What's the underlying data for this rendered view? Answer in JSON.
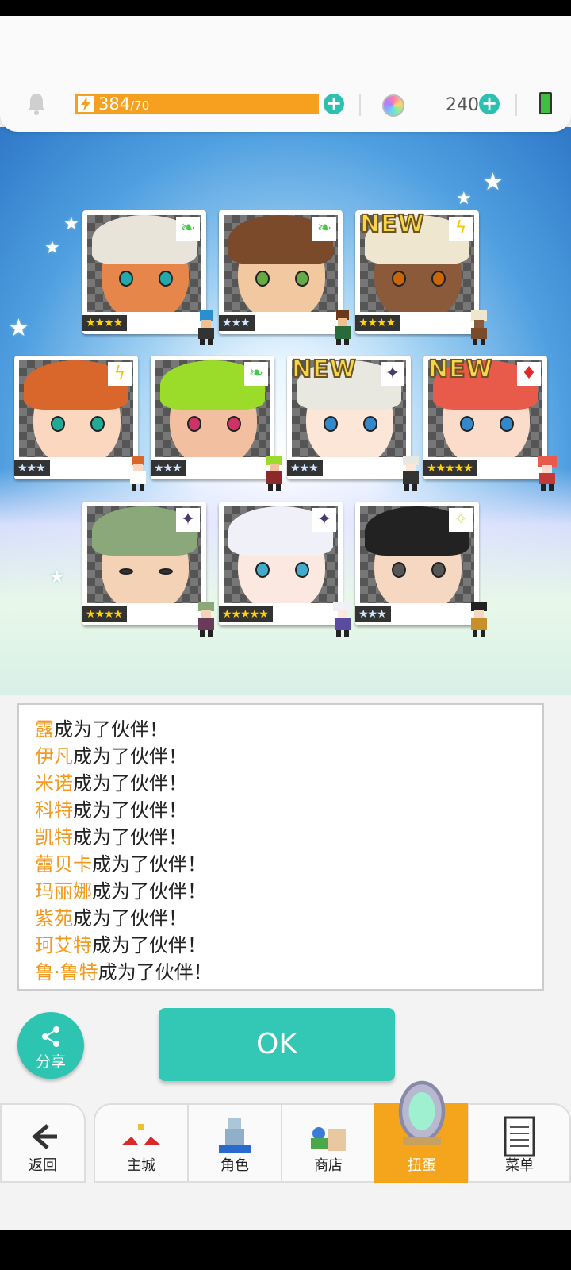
{
  "topbar": {
    "stamina_current": "384",
    "stamina_max": "/70",
    "gem_count": "240"
  },
  "cards": [
    {
      "stars": "★★★★",
      "rank_color": "gold",
      "badge": "leaf",
      "new": false
    },
    {
      "stars": "★★★",
      "rank_color": "silver",
      "badge": "leaf",
      "new": false
    },
    {
      "stars": "★★★★",
      "rank_color": "gold",
      "badge": "lightning",
      "new": true
    },
    {
      "stars": "★★★",
      "rank_color": "silver",
      "badge": "lightning",
      "new": false
    },
    {
      "stars": "★★★",
      "rank_color": "silver",
      "badge": "leaf",
      "new": false
    },
    {
      "stars": "★★★",
      "rank_color": "silver",
      "badge": "dark-star",
      "new": true
    },
    {
      "stars": "★★★★★",
      "rank_color": "gold",
      "badge": "fire-diamonds",
      "new": true
    },
    {
      "stars": "★★★★",
      "rank_color": "gold",
      "badge": "dark-star",
      "new": false
    },
    {
      "stars": "★★★★★",
      "rank_color": "gold",
      "badge": "dark-star",
      "new": false
    },
    {
      "stars": "★★★",
      "rank_color": "silver",
      "badge": "light-star",
      "new": false
    }
  ],
  "new_label": "NEW",
  "results": {
    "suffix": "成为了伙伴！",
    "names": [
      "露",
      "伊凡",
      "米诺",
      "科特",
      "凯特",
      "蕾贝卡",
      "玛丽娜",
      "紫苑",
      "珂艾特",
      "鲁·鲁特"
    ]
  },
  "share_label": "分享",
  "ok_label": "OK",
  "nav": {
    "back": "返回",
    "home": "主城",
    "character": "角色",
    "shop": "商店",
    "gacha": "扭蛋",
    "menu": "菜单"
  },
  "colors": {
    "accent": "#33c7b6",
    "stamina": "#f7a020",
    "name_highlight": "#f39a1e",
    "active_tab": "#f5a51c"
  }
}
